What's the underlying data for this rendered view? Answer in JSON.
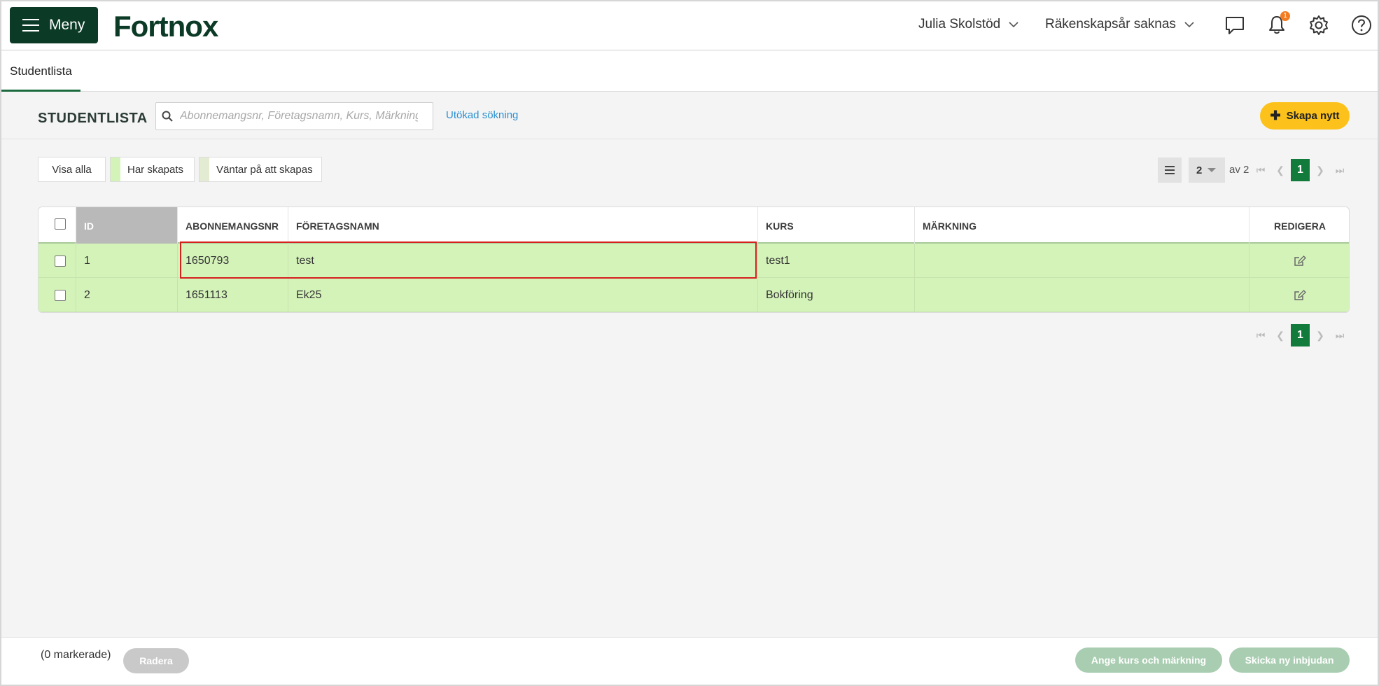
{
  "header": {
    "menu_label": "Meny",
    "logo_text": "Fortnox",
    "user_name": "Julia Skolstöd",
    "fiscal_year": "Räkenskapsår saknas",
    "notification_count": "1"
  },
  "tabs": [
    {
      "label": "Studentlista",
      "active": true
    }
  ],
  "page": {
    "title": "STUDENTLISTA",
    "search_placeholder": "Abonnemangsnr, Företagsnamn, Kurs, Märkning",
    "advanced_search": "Utökad sökning",
    "create_label": "Skapa nytt"
  },
  "filters": {
    "show_all": "Visa alla",
    "created": "Har skapats",
    "waiting": "Väntar på att skapas",
    "created_color": "#d4f3b9",
    "waiting_color": "#e3ecd3"
  },
  "pager": {
    "page_size": "2",
    "of_label": "av 2",
    "current_page": "1"
  },
  "table": {
    "columns": [
      "ID",
      "ABONNEMANGSNR",
      "FÖRETAGSNAMN",
      "KURS",
      "MÄRKNING",
      "REDIGERA"
    ],
    "rows": [
      {
        "id": "1",
        "subscription": "1650793",
        "company": "test",
        "course": "test1",
        "marking": ""
      },
      {
        "id": "2",
        "subscription": "1651113",
        "company": "Ek25",
        "course": "Bokföring",
        "marking": ""
      }
    ]
  },
  "footer": {
    "selected_count": "(0 markerade)",
    "delete_label": "Radera",
    "set_course_label": "Ange kurs och märkning",
    "send_invite_label": "Skicka ny inbjudan"
  },
  "colors": {
    "brand": "#0b3a26",
    "accent": "#fcc21b",
    "row_bg": "#d4f3b9",
    "pager_active": "#127a3a",
    "highlight": "#d61f1f"
  }
}
